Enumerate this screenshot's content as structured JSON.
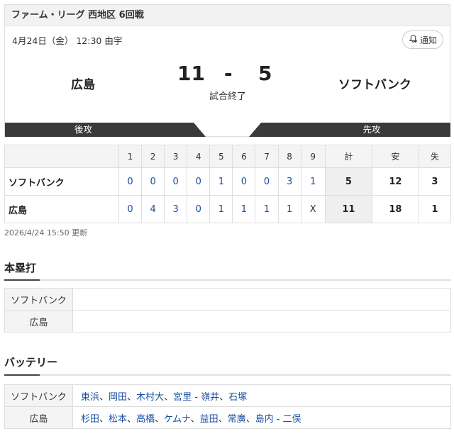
{
  "game": {
    "league": "ファーム・リーグ 西地区 6回戦",
    "date": "4月24日（金） 12:30 由宇",
    "notify_label": "通知",
    "home_team": "広島",
    "away_team": "ソフトバンク",
    "home_score": "11",
    "dash": "-",
    "away_score": "5",
    "status": "試合終了",
    "home_bat": "後攻",
    "away_bat": "先攻"
  },
  "scoreboard": {
    "headers": [
      "1",
      "2",
      "3",
      "4",
      "5",
      "6",
      "7",
      "8",
      "9",
      "計",
      "安",
      "失"
    ],
    "rows": [
      {
        "team": "ソフトバンク",
        "innings": [
          "0",
          "0",
          "0",
          "0",
          "1",
          "0",
          "0",
          "3",
          "1"
        ],
        "total": "5",
        "hits": "12",
        "errors": "3"
      },
      {
        "team": "広島",
        "innings": [
          "0",
          "4",
          "3",
          "0",
          "1",
          "1",
          "1",
          "1",
          "X"
        ],
        "total": "11",
        "hits": "18",
        "errors": "1"
      }
    ],
    "updated": "2026/4/24 15:50 更新"
  },
  "homeruns": {
    "title": "本塁打",
    "rows": [
      {
        "team": "ソフトバンク",
        "value": ""
      },
      {
        "team": "広島",
        "value": ""
      }
    ]
  },
  "battery": {
    "title": "バッテリー",
    "separator": "、",
    "dash": "-",
    "rows": [
      {
        "team": "ソフトバンク",
        "pitchers": [
          "東浜",
          "岡田",
          "木村大",
          "宮里"
        ],
        "catchers": [
          "嶺井",
          "石塚"
        ]
      },
      {
        "team": "広島",
        "pitchers": [
          "杉田",
          "松本",
          "高橋",
          "ケムナ",
          "益田",
          "常廣",
          "島内"
        ],
        "catchers": [
          "二俣"
        ]
      }
    ]
  },
  "colors": {
    "link": "#1a4fa0",
    "bar": "#3a3a3a",
    "total_bg": "#efefef"
  }
}
